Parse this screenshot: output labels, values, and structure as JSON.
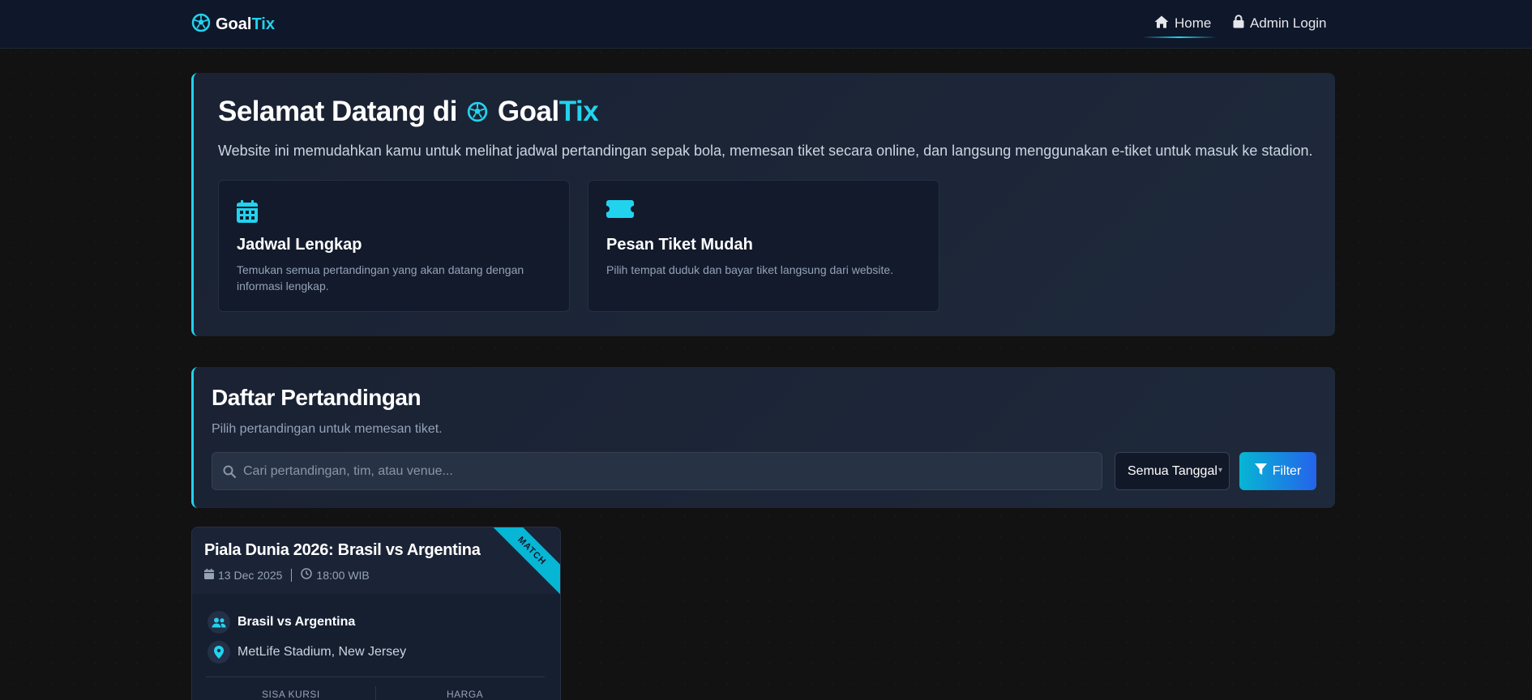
{
  "nav": {
    "brand_prefix": "Goal",
    "brand_accent": "Tix",
    "home_label": "Home",
    "admin_label": "Admin Login"
  },
  "hero": {
    "title_prefix": "Selamat Datang di",
    "brand_prefix": "Goal",
    "brand_accent": "Tix",
    "description": "Website ini memudahkan kamu untuk melihat jadwal pertandingan sepak bola, memesan tiket secara online, dan langsung menggunakan e-tiket untuk masuk ke stadion.",
    "features": [
      {
        "icon": "calendar-icon",
        "title": "Jadwal Lengkap",
        "description": "Temukan semua pertandingan yang akan datang dengan informasi lengkap."
      },
      {
        "icon": "ticket-icon",
        "title": "Pesan Tiket Mudah",
        "description": "Pilih tempat duduk dan bayar tiket langsung dari website."
      }
    ]
  },
  "matches": {
    "title": "Daftar Pertandingan",
    "subtitle": "Pilih pertandingan untuk memesan tiket.",
    "search_placeholder": "Cari pertandingan, tim, atau venue...",
    "date_filter_selected": "Semua Tanggal",
    "filter_button": "Filter",
    "cards": [
      {
        "title": "Piala Dunia 2026: Brasil vs Argentina",
        "date": "13 Dec 2025",
        "time": "18:00 WIB",
        "badge": "MATCH",
        "teams": "Brasil vs Argentina",
        "venue": "MetLife Stadium, New Jersey",
        "stat_seats_label": "SISA KURSI",
        "stat_price_label": "HARGA"
      }
    ]
  },
  "colors": {
    "accent": "#22d3ee",
    "background": "#121212",
    "panel": "#1e293b",
    "filter_gradient_start": "#06b6d4",
    "filter_gradient_end": "#2563eb"
  }
}
